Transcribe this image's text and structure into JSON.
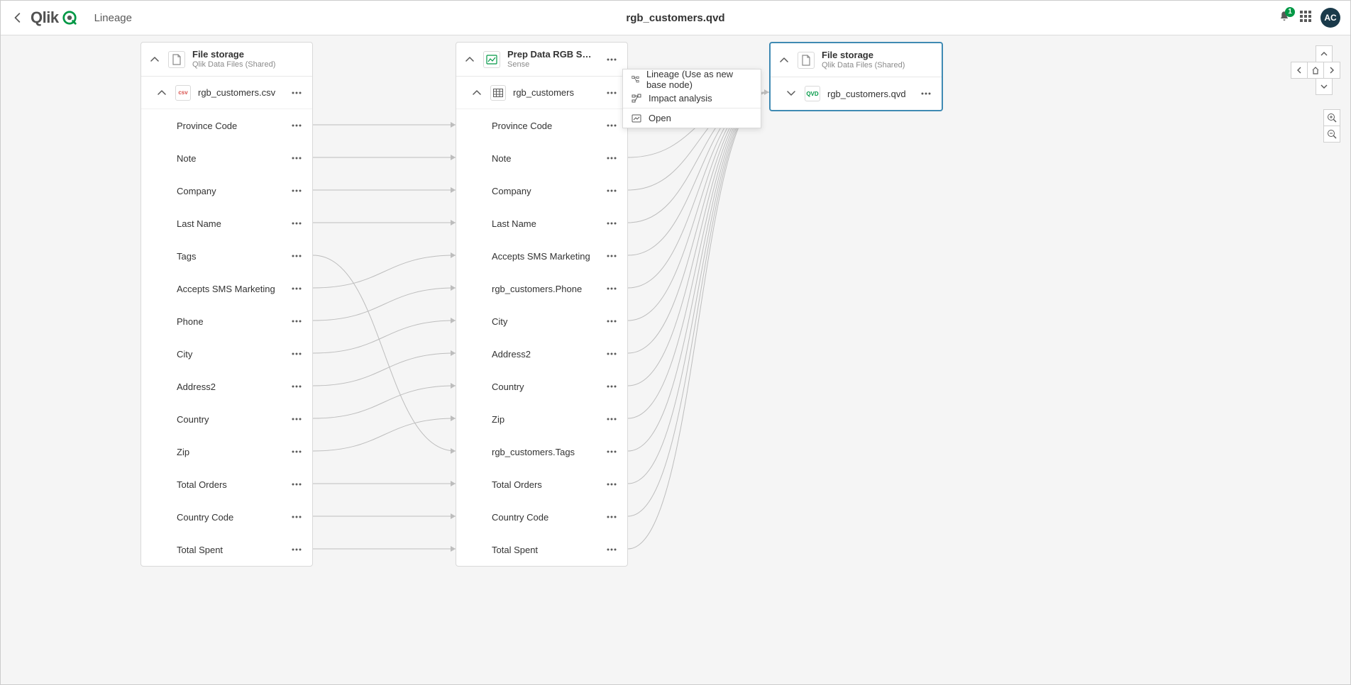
{
  "header": {
    "page_title": "Lineage",
    "file_name": "rgb_customers.qvd",
    "notification_count": "1",
    "avatar_initials": "AC",
    "logo_text": "Qlik"
  },
  "context_menu": {
    "lineage_label": "Lineage (Use as new base node)",
    "impact_label": "Impact analysis",
    "open_label": "Open"
  },
  "cards": {
    "left": {
      "header_title": "File storage",
      "header_sub": "Qlik Data Files (Shared)",
      "table_name": "rgb_customers.csv",
      "fields": [
        "Province Code",
        "Note",
        "Company",
        "Last Name",
        "Tags",
        "Accepts SMS Marketing",
        "Phone",
        "City",
        "Address2",
        "Country",
        "Zip",
        "Total Orders",
        "Country Code",
        "Total Spent"
      ]
    },
    "middle": {
      "header_title": "Prep Data RGB Sales A…",
      "header_sub": "Sense",
      "table_name": "rgb_customers",
      "fields": [
        "Province Code",
        "Note",
        "Company",
        "Last Name",
        "Accepts SMS Marketing",
        "rgb_customers.Phone",
        "City",
        "Address2",
        "Country",
        "Zip",
        "rgb_customers.Tags",
        "Total Orders",
        "Country Code",
        "Total Spent"
      ]
    },
    "right": {
      "header_title": "File storage",
      "header_sub": "Qlik Data Files (Shared)",
      "table_name": "rgb_customers.qvd"
    }
  }
}
